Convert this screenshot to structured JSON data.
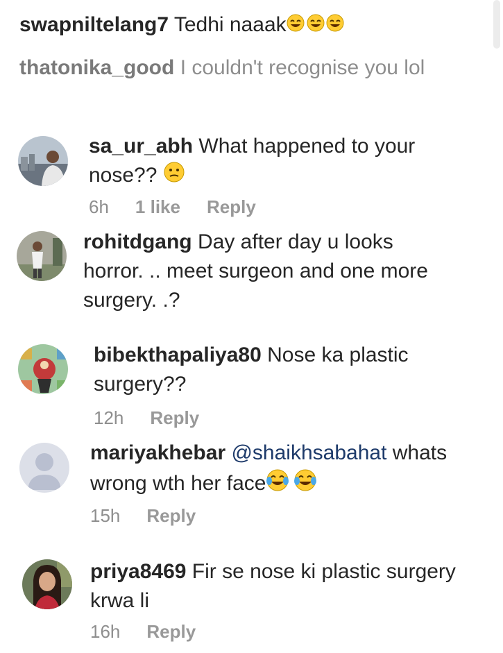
{
  "comments_top": [
    {
      "username": "swapniltelang7",
      "text": "Tedhi naaak"
    },
    {
      "username": "thatonika_good",
      "text": "I couldn't recognise you lol"
    }
  ],
  "comments": [
    {
      "username": "sa_ur_abh",
      "text": "What happened to your nose??",
      "time": "6h",
      "likes": "1 like",
      "reply": "Reply"
    },
    {
      "username": "rohitdgang",
      "text": "Day after day u looks horror. .. meet surgeon and one more surgery. .?"
    },
    {
      "username": "bibekthapaliya80",
      "text": "Nose ka plastic surgery??",
      "time": "12h",
      "reply": "Reply"
    },
    {
      "username": "mariyakhebar",
      "mention": "@shaikhsabahat",
      "text": "whats wrong wth her face",
      "time": "15h",
      "reply": "Reply"
    },
    {
      "username": "priya8469",
      "text": "Fir se nose ki plastic surgery krwa li",
      "time": "16h",
      "reply": "Reply"
    }
  ],
  "colors": {
    "text": "#262626",
    "meta": "#8e8e8e",
    "mention": "#1d3a6a",
    "emoji": "#ffcc33"
  }
}
